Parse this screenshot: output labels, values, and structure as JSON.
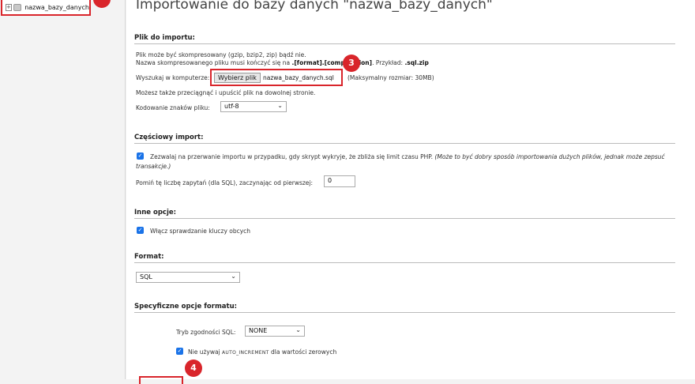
{
  "sidebar": {
    "db_name": "nazwa_bazy_danych",
    "expand_icon": "plus-icon",
    "db_icon": "database-icon"
  },
  "page": {
    "title": "Importowanie do bazy danych \"nazwa_bazy_danych\""
  },
  "file_section": {
    "header": "Plik do importu:",
    "line1": "Plik może być skompresowany (gzip, bzip2, zip) bądź nie.",
    "line2_prefix": "Nazwa skompresowanego pliku musi kończyć się na ",
    "line2_bold": ".[format].[compression]",
    "line2_mid": ". Przykład: ",
    "line2_example": ".sql.zip",
    "browse_label": "Wyszukaj w komputerze:",
    "choose_button": "Wybierz plik",
    "file_name": "nazwa_bazy_danych.sql",
    "max_size": "(Maksymalny rozmiar: 30MB)",
    "drag_hint": "Możesz także przeciągnąć i upuścić plik na dowolnej stronie.",
    "encoding_label": "Kodowanie znaków pliku:",
    "encoding_value": "utf-8"
  },
  "partial_section": {
    "header": "Częściowy import:",
    "allow_interrupt": "Zezwalaj na przerwanie importu w przypadku, gdy skrypt wykryje, że zbliża się limit czasu PHP.",
    "allow_interrupt_note_1": "(Może to być dobry sposób importowania dużych plików, jednak może zepsuć",
    "allow_interrupt_note_2": "transakcje.)",
    "skip_label": "Pomiń tę liczbę zapytań (dla SQL), zaczynając od pierwszej:",
    "skip_value": "0"
  },
  "other_section": {
    "header": "Inne opcje:",
    "fk_checks": "Włącz sprawdzanie kluczy obcych"
  },
  "format_section": {
    "header": "Format:",
    "format_value": "SQL"
  },
  "specific_section": {
    "header": "Specyficzne opcje formatu:",
    "compat_label": "Tryb zgodności SQL:",
    "compat_value": "NONE",
    "ai_prefix": "Nie używaj ",
    "ai_code": "AUTO_INCREMENT",
    "ai_suffix": " dla wartości zerowych"
  },
  "badges": {
    "three": "3",
    "four": "4"
  },
  "colors": {
    "accent_red": "#d9252b",
    "checkbox_blue": "#1a73e8"
  }
}
